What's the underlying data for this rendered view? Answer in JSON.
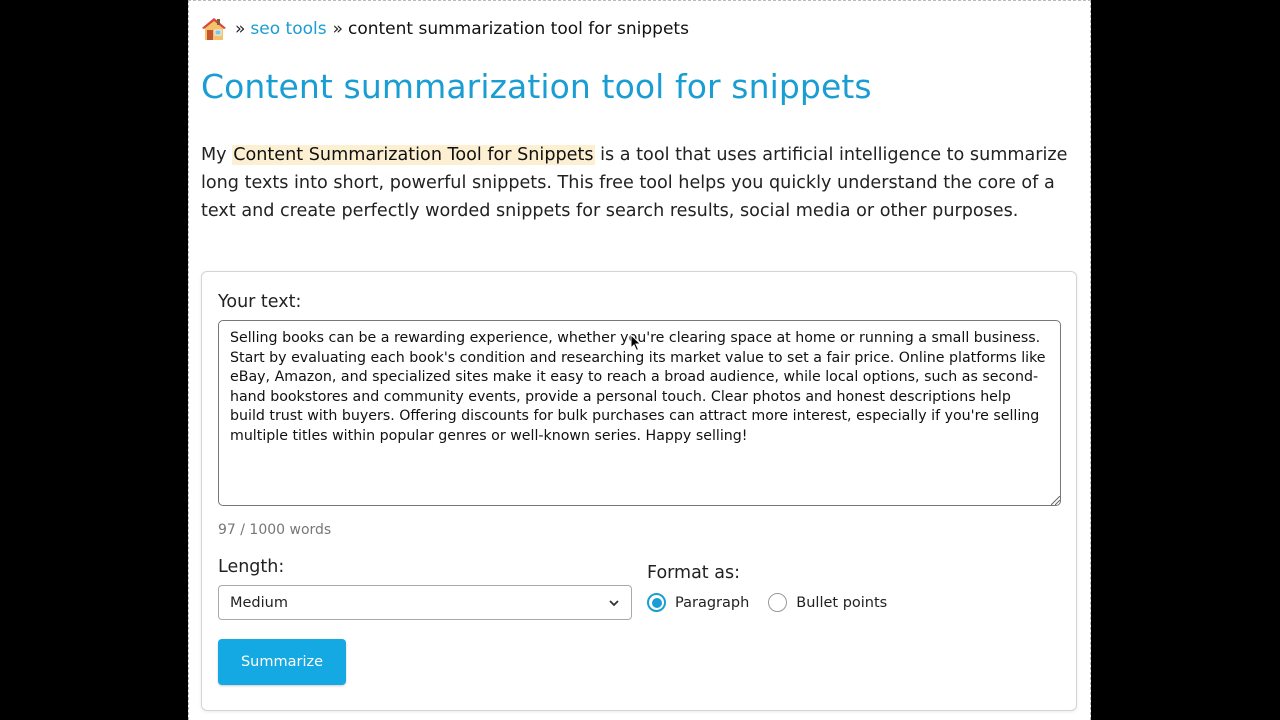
{
  "breadcrumb": {
    "separator": "»",
    "link": "seo tools",
    "current": "content summarization tool for snippets"
  },
  "title": "Content summarization tool for snippets",
  "intro": {
    "before": "My ",
    "highlight": "Content Summarization Tool for Snippets",
    "after": " is a tool that uses artificial intelligence to summarize long texts into short, powerful snippets. This free tool helps you quickly understand the core of a text and create perfectly worded snippets for search results, social media or other purposes."
  },
  "form": {
    "text_label": "Your text:",
    "text_value": "Selling books can be a rewarding experience, whether you're clearing space at home or running a small business. Start by evaluating each book's condition and researching its market value to set a fair price. Online platforms like eBay, Amazon, and specialized sites make it easy to reach a broad audience, while local options, such as second-hand bookstores and community events, provide a personal touch. Clear photos and honest descriptions help build trust with buyers. Offering discounts for bulk purchases can attract more interest, especially if you're selling multiple titles within popular genres or well-known series. Happy selling!",
    "word_count": "97 / 1000 words",
    "length_label": "Length:",
    "length_value": "Medium",
    "format_label": "Format as:",
    "format_options": [
      "Paragraph",
      "Bullet points"
    ],
    "format_selected": "Paragraph",
    "submit_label": "Summarize"
  },
  "colors": {
    "accent": "#1a9dd3",
    "button": "#14a9e2",
    "highlight": "#fdefd2"
  }
}
